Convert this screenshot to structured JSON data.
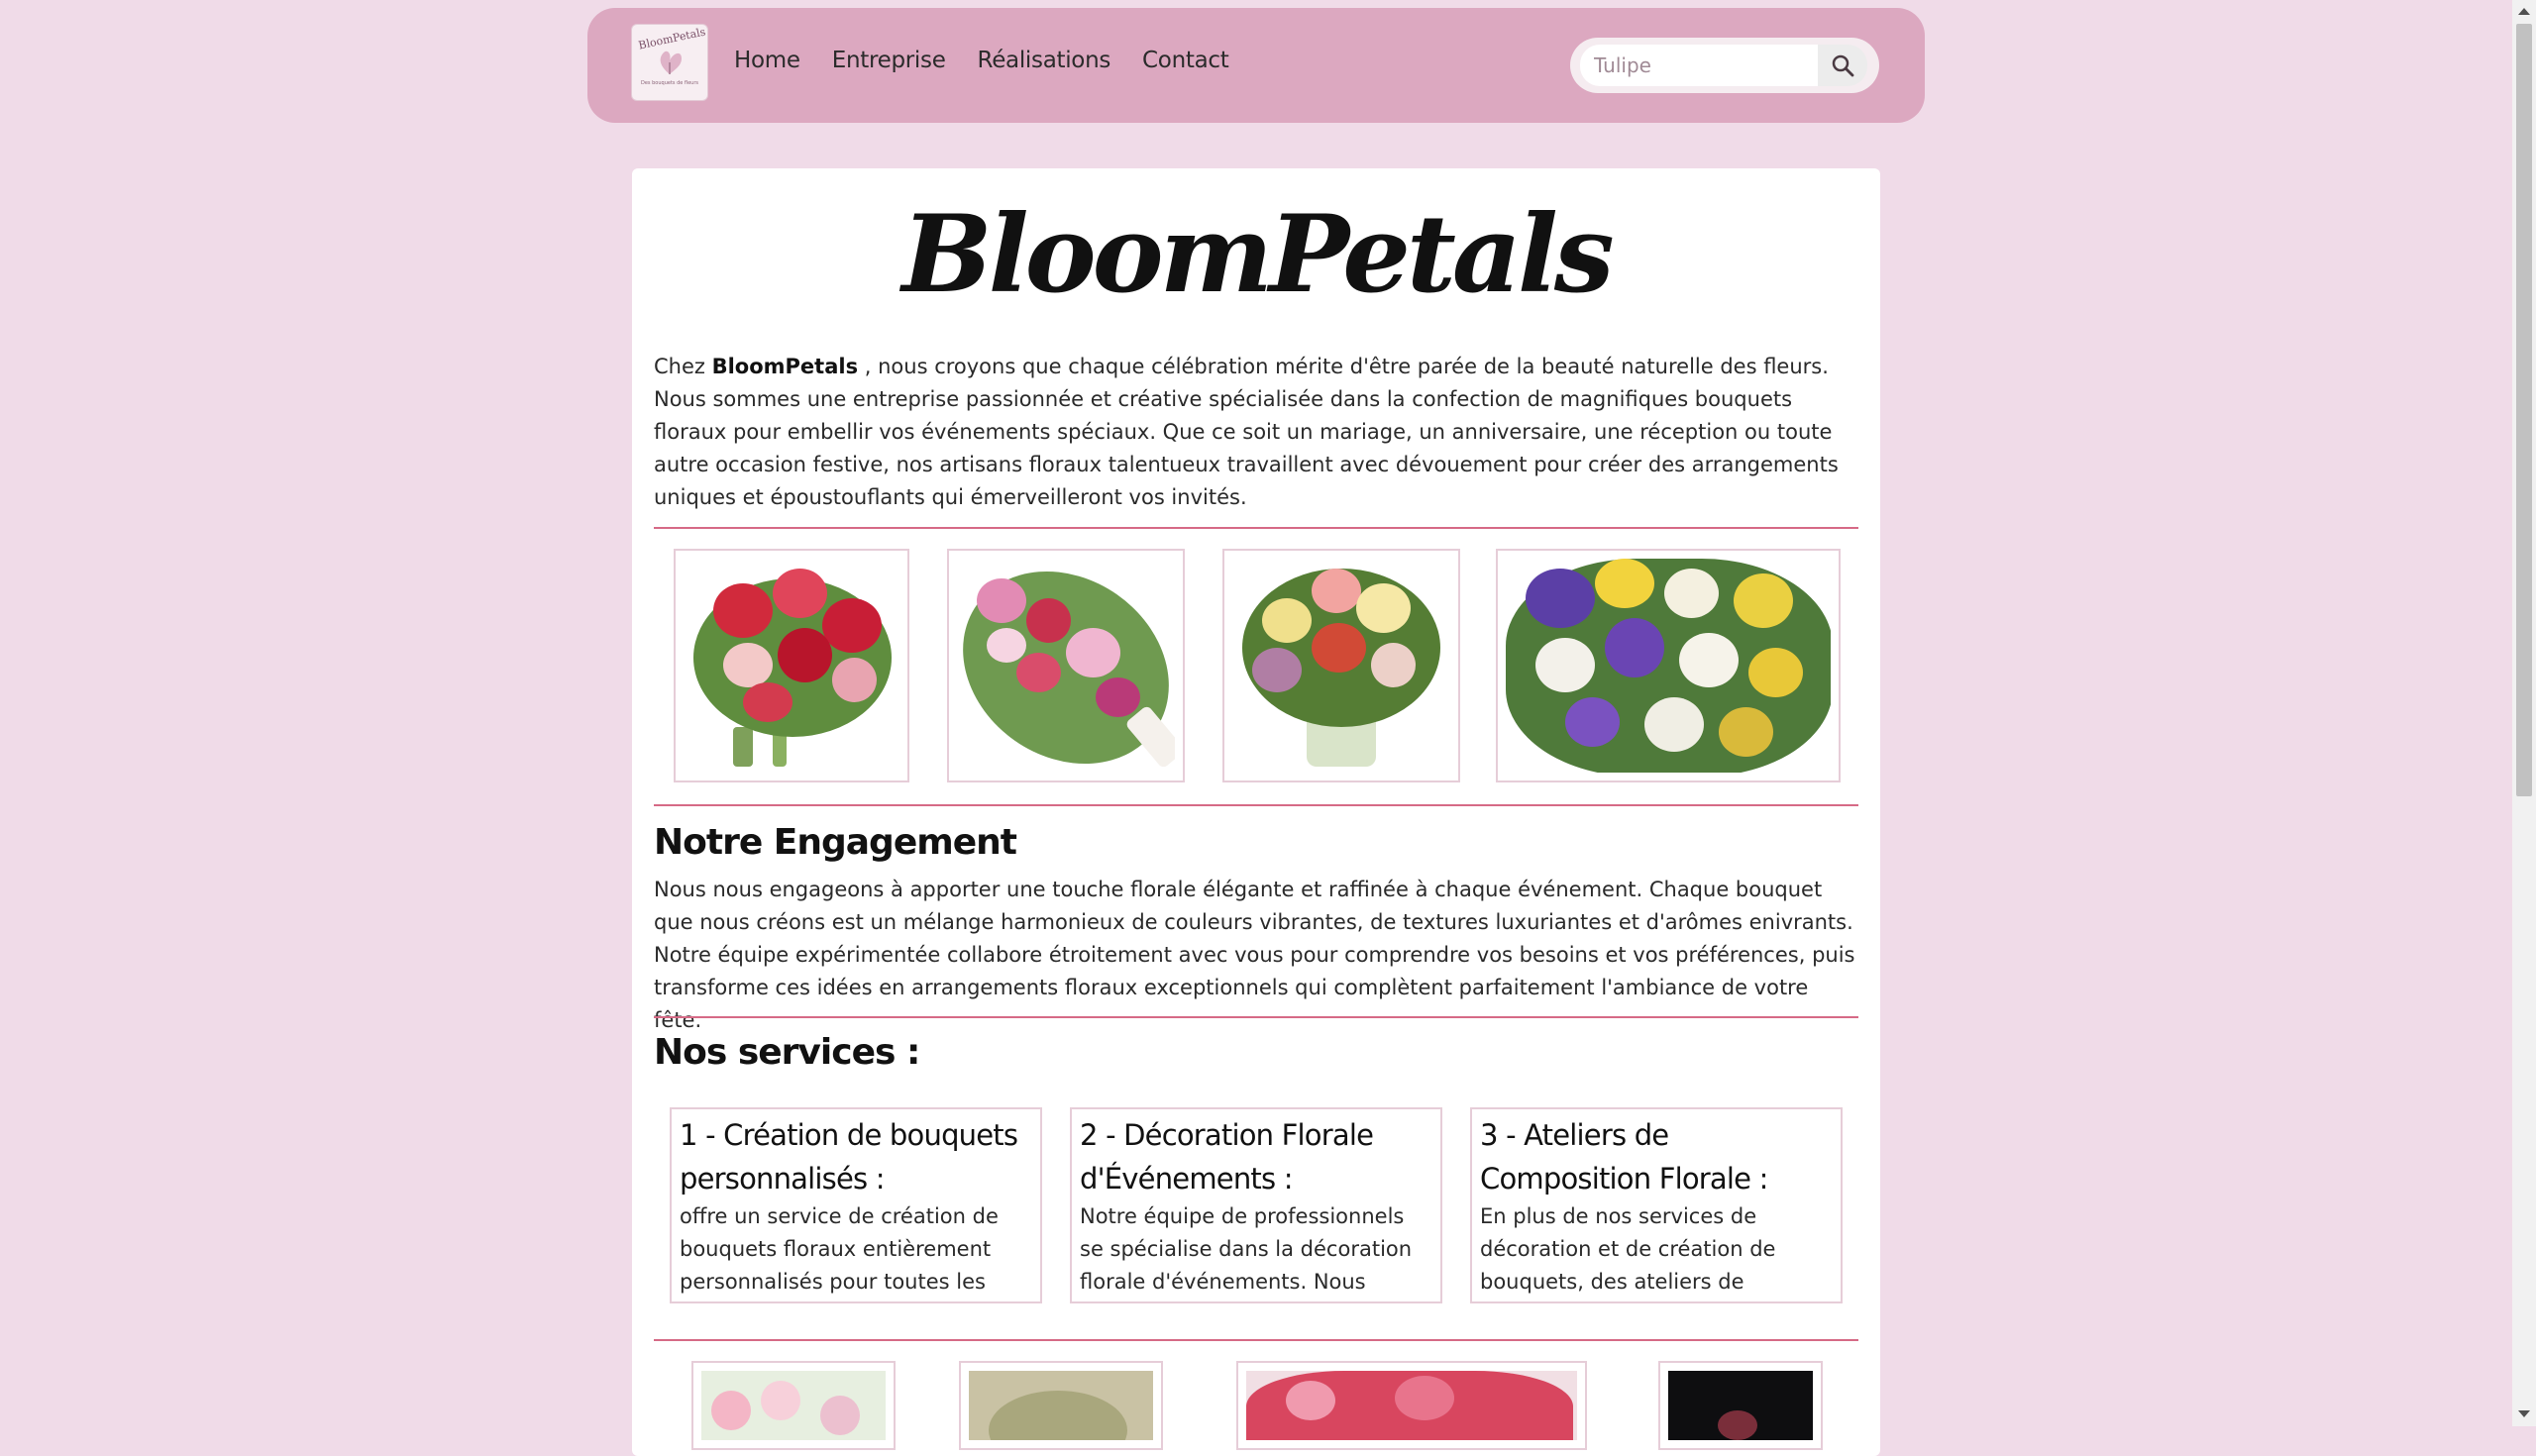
{
  "nav": {
    "logo_text": "BloomPetals",
    "logo_subtitle": "Des bouquets de fleurs",
    "links": [
      "Home",
      "Entreprise",
      "Réalisations",
      "Contact"
    ],
    "search": {
      "placeholder": "Tulipe"
    }
  },
  "brand": {
    "title": "BloomPetals"
  },
  "intro": {
    "prefix": "Chez ",
    "brand": "BloomPetals",
    "text": " , nous croyons que chaque célébration mérite d'être parée de la beauté naturelle des fleurs. Nous sommes une entreprise passionnée et créative spécialisée dans la confection de magnifiques bouquets floraux pour embellir vos événements spéciaux. Que ce soit un mariage, un anniversaire, une réception ou toute autre occasion festive, nos artisans floraux talentueux travaillent avec dévouement pour créer des arrangements uniques et époustouflants qui émerveilleront vos invités."
  },
  "engagement": {
    "heading": "Notre Engagement",
    "text": "Nous nous engageons à apporter une touche florale élégante et raffinée à chaque événement. Chaque bouquet que nous créons est un mélange harmonieux de couleurs vibrantes, de textures luxuriantes et d'arômes enivrants. Notre équipe expérimentée collabore étroitement avec vous pour comprendre vos besoins et vos préférences, puis transforme ces idées en arrangements floraux exceptionnels qui complètent parfaitement l'ambiance de votre fête."
  },
  "services": {
    "heading": "Nos services :",
    "items": [
      {
        "title": "1 - Création de bouquets personnalisés :",
        "text": "offre un service de création de bouquets floraux entièrement personnalisés pour toutes les"
      },
      {
        "title": "2 - Décoration Florale d'Événements :",
        "text": "Notre équipe de professionnels se spécialise dans la décoration florale d'événements. Nous transformons"
      },
      {
        "title": "3 - Ateliers de Composition Florale :",
        "text": "En plus de nos services de décoration et de création de bouquets, des ateliers de"
      }
    ]
  },
  "colors": {
    "page_bg": "#f0dbe8",
    "nav_bg": "#dca8c0",
    "divider": "#d66a86"
  }
}
